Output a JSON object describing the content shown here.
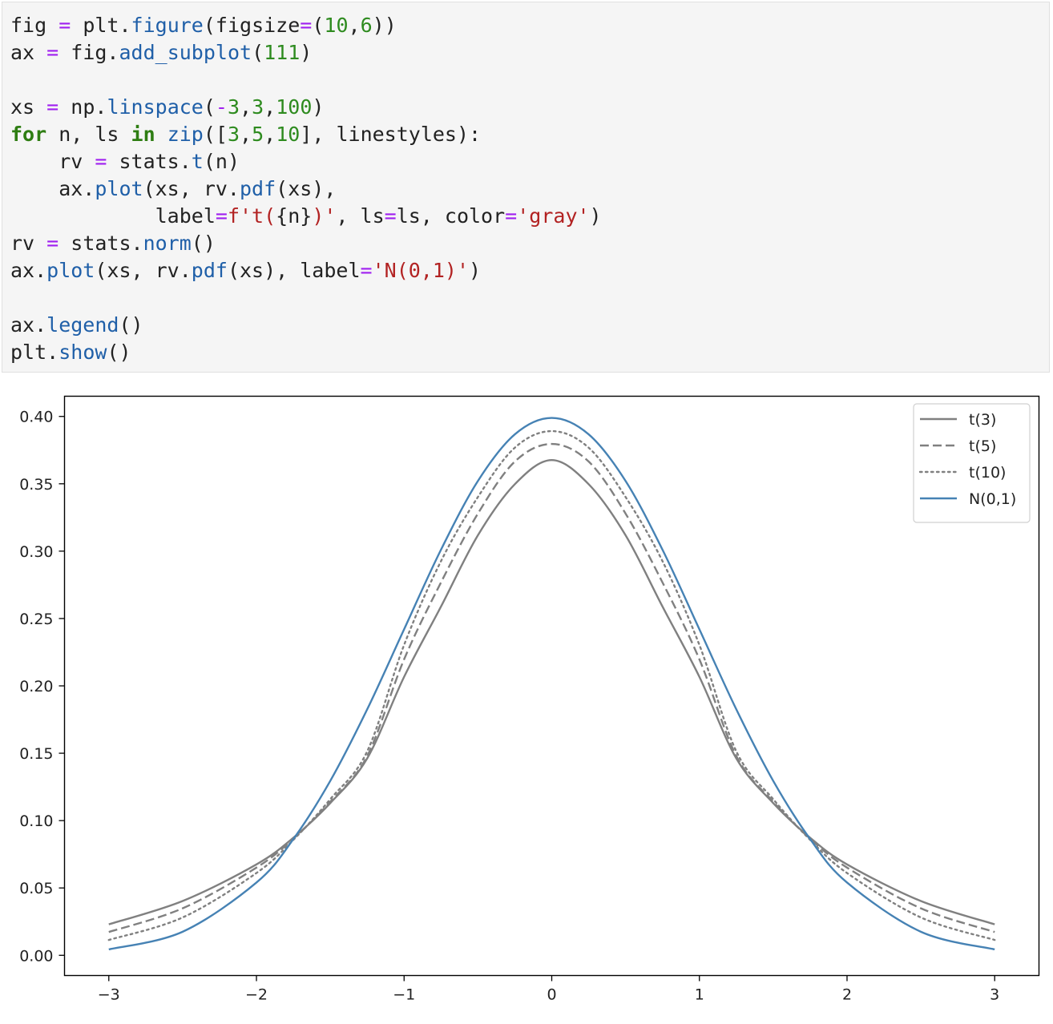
{
  "code_cell": {
    "lines": [
      [
        [
          "fig ",
          ""
        ],
        [
          "=",
          "op"
        ],
        [
          " plt.",
          ""
        ],
        [
          "figure",
          "fn"
        ],
        [
          "(figsize",
          ""
        ],
        [
          "=",
          "op"
        ],
        [
          "(",
          ""
        ],
        [
          "10",
          "num"
        ],
        [
          ",",
          ""
        ],
        [
          "6",
          "num"
        ],
        [
          "))",
          ""
        ]
      ],
      [
        [
          "ax ",
          ""
        ],
        [
          "=",
          "op"
        ],
        [
          " fig.",
          ""
        ],
        [
          "add_subplot",
          "fn"
        ],
        [
          "(",
          ""
        ],
        [
          "111",
          "num"
        ],
        [
          ")",
          ""
        ]
      ],
      [],
      [
        [
          "xs ",
          ""
        ],
        [
          "=",
          "op"
        ],
        [
          " np.",
          ""
        ],
        [
          "linspace",
          "fn"
        ],
        [
          "(",
          ""
        ],
        [
          "-",
          "op"
        ],
        [
          "3",
          "num"
        ],
        [
          ",",
          ""
        ],
        [
          "3",
          "num"
        ],
        [
          ",",
          ""
        ],
        [
          "100",
          "num"
        ],
        [
          ")",
          ""
        ]
      ],
      [
        [
          "for",
          "kw"
        ],
        [
          " n, ls ",
          ""
        ],
        [
          "in",
          "kw"
        ],
        [
          " ",
          ""
        ],
        [
          "zip",
          "fn"
        ],
        [
          "([",
          ""
        ],
        [
          "3",
          "num"
        ],
        [
          ",",
          ""
        ],
        [
          "5",
          "num"
        ],
        [
          ",",
          ""
        ],
        [
          "10",
          "num"
        ],
        [
          "], linestyles):",
          ""
        ]
      ],
      [
        [
          "    rv ",
          ""
        ],
        [
          "=",
          "op"
        ],
        [
          " stats.",
          ""
        ],
        [
          "t",
          "fn"
        ],
        [
          "(n)",
          ""
        ]
      ],
      [
        [
          "    ax.",
          ""
        ],
        [
          "plot",
          "fn"
        ],
        [
          "(xs, rv.",
          ""
        ],
        [
          "pdf",
          "fn"
        ],
        [
          "(xs),",
          ""
        ]
      ],
      [
        [
          "            label",
          ""
        ],
        [
          "=",
          "op"
        ],
        [
          "f't(",
          "str"
        ],
        [
          "{n}",
          ""
        ],
        [
          ")'",
          "str"
        ],
        [
          ", ls",
          ""
        ],
        [
          "=",
          "op"
        ],
        [
          "ls, color",
          ""
        ],
        [
          "=",
          "op"
        ],
        [
          "'gray'",
          "str"
        ],
        [
          ")",
          ""
        ]
      ],
      [
        [
          "rv ",
          ""
        ],
        [
          "=",
          "op"
        ],
        [
          " stats.",
          ""
        ],
        [
          "norm",
          "fn"
        ],
        [
          "()",
          ""
        ]
      ],
      [
        [
          "ax.",
          ""
        ],
        [
          "plot",
          "fn"
        ],
        [
          "(xs, rv.",
          ""
        ],
        [
          "pdf",
          "fn"
        ],
        [
          "(xs), label",
          ""
        ],
        [
          "=",
          "op"
        ],
        [
          "'N(0,1)'",
          "str"
        ],
        [
          ")",
          ""
        ]
      ],
      [],
      [
        [
          "ax.",
          ""
        ],
        [
          "legend",
          "fn"
        ],
        [
          "()",
          ""
        ]
      ],
      [
        [
          "plt.",
          ""
        ],
        [
          "show",
          "fn"
        ],
        [
          "()",
          ""
        ]
      ]
    ]
  },
  "chart_data": {
    "type": "line",
    "title": "",
    "xlabel": "",
    "ylabel": "",
    "xlim": [
      -3.3,
      3.3
    ],
    "ylim": [
      -0.015,
      0.415
    ],
    "x_ticks": [
      -3,
      -2,
      -1,
      0,
      1,
      2,
      3
    ],
    "x_tick_labels": [
      "−3",
      "−2",
      "−1",
      "0",
      "1",
      "2",
      "3"
    ],
    "y_ticks": [
      0.0,
      0.05,
      0.1,
      0.15,
      0.2,
      0.25,
      0.3,
      0.35,
      0.4
    ],
    "y_tick_labels": [
      "0.00",
      "0.05",
      "0.10",
      "0.15",
      "0.20",
      "0.25",
      "0.30",
      "0.35",
      "0.40"
    ],
    "grid": false,
    "legend_position": "top-right",
    "x": [
      -3.0,
      -2.5,
      -2.0,
      -1.75,
      -1.5,
      -1.25,
      -1.0,
      -0.75,
      -0.5,
      -0.25,
      0.0,
      0.25,
      0.5,
      0.75,
      1.0,
      1.25,
      1.5,
      1.75,
      2.0,
      2.5,
      3.0
    ],
    "series": [
      {
        "name": "t(3)",
        "color": "#808080",
        "linestyle": "solid",
        "values": [
          0.023,
          0.0403,
          0.0675,
          0.0873,
          0.113,
          0.1462,
          0.2067,
          0.2589,
          0.3118,
          0.3497,
          0.3676,
          0.3497,
          0.3118,
          0.2589,
          0.2067,
          0.1462,
          0.113,
          0.0873,
          0.0675,
          0.0403,
          0.023
        ]
      },
      {
        "name": "t(5)",
        "color": "#808080",
        "linestyle": "dashed",
        "values": [
          0.0173,
          0.0349,
          0.0651,
          0.0866,
          0.114,
          0.1479,
          0.2197,
          0.2768,
          0.3279,
          0.3665,
          0.3796,
          0.3665,
          0.3279,
          0.2768,
          0.2197,
          0.1479,
          0.114,
          0.0866,
          0.0651,
          0.0349,
          0.0173
        ]
      },
      {
        "name": "t(10)",
        "color": "#808080",
        "linestyle": "dotted",
        "values": [
          0.0114,
          0.0281,
          0.0611,
          0.0857,
          0.1159,
          0.1514,
          0.2304,
          0.2926,
          0.3402,
          0.3768,
          0.3891,
          0.3768,
          0.3402,
          0.2926,
          0.2304,
          0.1514,
          0.1159,
          0.0857,
          0.0611,
          0.0281,
          0.0114
        ]
      },
      {
        "name": "N(0,1)",
        "color": "#4682b4",
        "linestyle": "solid",
        "values": [
          0.0044,
          0.0175,
          0.054,
          0.0863,
          0.1295,
          0.1826,
          0.242,
          0.3011,
          0.3521,
          0.3867,
          0.3989,
          0.3867,
          0.3521,
          0.3011,
          0.242,
          0.1826,
          0.1295,
          0.0863,
          0.054,
          0.0175,
          0.0044
        ]
      }
    ]
  }
}
